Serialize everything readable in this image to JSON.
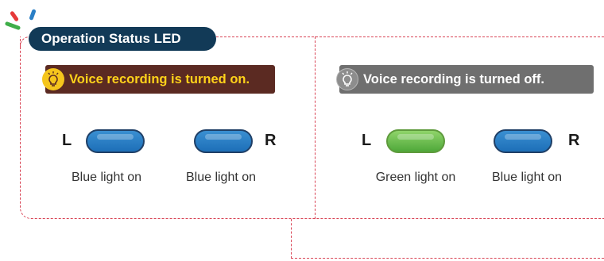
{
  "title": "Operation Status LED",
  "colors": {
    "title_bg": "#123a57",
    "dash": "#d94455",
    "banner_on_bg": "#5b2a22",
    "banner_on_text": "#ffd21a",
    "banner_off_bg": "#6f6f6f",
    "led_blue": "#2a7fc6",
    "led_green": "#6cbf4c"
  },
  "panels": [
    {
      "status": "Voice recording is turned on.",
      "icon": "lightbulb-icon",
      "left_letter": "L",
      "right_letter": "R",
      "left_caption": "Blue light on",
      "right_caption": "Blue light on",
      "left_led": "blue",
      "right_led": "blue"
    },
    {
      "status": "Voice recording is turned off.",
      "icon": "lightbulb-icon",
      "left_letter": "L",
      "right_letter": "R",
      "left_caption": "Green light on",
      "right_caption": "Blue light on",
      "left_led": "green",
      "right_led": "blue"
    }
  ]
}
